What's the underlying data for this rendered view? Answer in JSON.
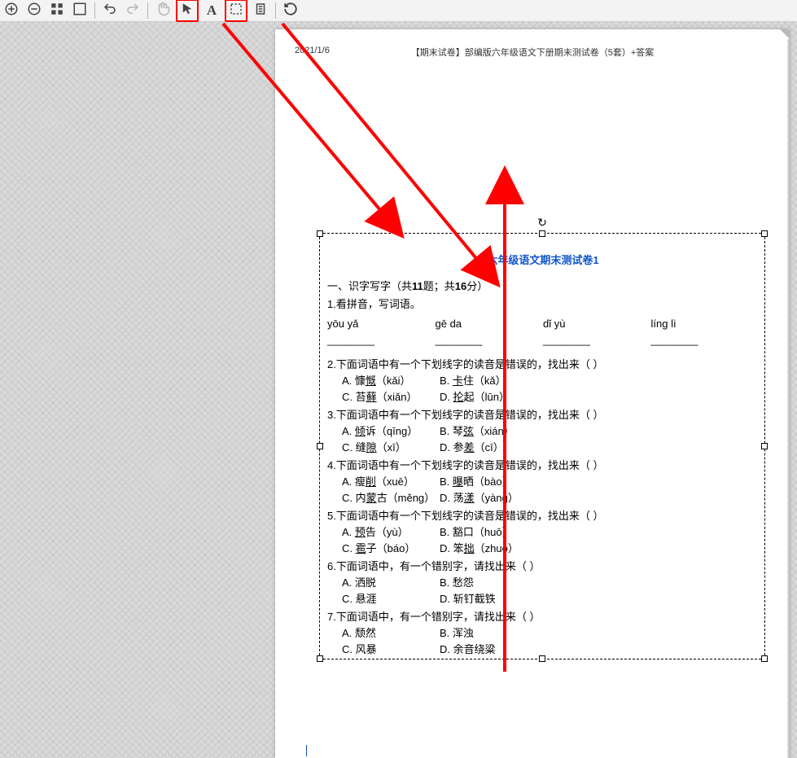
{
  "toolbar": {
    "zoom_in": {
      "name": "zoom-in-icon"
    },
    "zoom_out": {
      "name": "zoom-out-icon"
    },
    "thumbs": {
      "name": "thumbnails-icon"
    },
    "fit": {
      "name": "fit-page-icon"
    },
    "undo": {
      "name": "undo-icon"
    },
    "redo": {
      "name": "redo-icon"
    },
    "hand": {
      "name": "hand-tool-icon"
    },
    "pointer": {
      "name": "pointer-tool-icon"
    },
    "text": {
      "name": "text-tool-label",
      "label": "A"
    },
    "marquee": {
      "name": "marquee-select-icon"
    },
    "clipboard": {
      "name": "clipboard-icon"
    },
    "refresh": {
      "name": "refresh-icon"
    }
  },
  "annotation": {
    "arrow1_from": "pointer-tool",
    "arrow2_from": "marquee-tool",
    "arrow3": "vertical-double-arrow"
  },
  "page_header": {
    "date": "2021/1/6",
    "title": "【期末试卷】部编版六年级语文下册期末测试卷（5套）+答案"
  },
  "selection_handles": {
    "count": 8,
    "rotate_glyph": "↻"
  },
  "doc": {
    "title": "六年级语文期末测试卷1",
    "section": "一、识字写字（共11题；共16分）",
    "q1": {
      "prompt": "1.看拼音，写词语。",
      "pinyin": [
        "yōu yǎ",
        "gē da",
        "dǐ yù",
        "líng lì"
      ],
      "blanks": [
        "________",
        "________",
        "________",
        "________"
      ]
    },
    "q2": {
      "prompt": "2.下面词语中有一个下划线字的读音是错误的，找出来（     ）",
      "opts": [
        {
          "k": "A",
          "t": "慷",
          "u": "慨",
          "py": "（kǎi）"
        },
        {
          "k": "B",
          "t": "",
          "u": "卡",
          "t2": "住",
          "py": "（kǎ）"
        },
        {
          "k": "C",
          "t": "苔",
          "u": "藓",
          "py": "（xiǎn）"
        },
        {
          "k": "D",
          "t": "",
          "u": "抡",
          "t2": "起",
          "py": "（lūn）"
        }
      ]
    },
    "q3": {
      "prompt": "3.下面词语中有一个下划线字的读音是错误的，找出来（     ）",
      "opts": [
        {
          "k": "A",
          "u": "倾",
          "t2": "诉",
          "py": "（qīng）"
        },
        {
          "k": "B",
          "t": "琴",
          "u": "弦",
          "py": "（xián）"
        },
        {
          "k": "C",
          "t": "缝",
          "u": "隙",
          "py": "（xī）"
        },
        {
          "k": "D",
          "t": "参",
          "u": "差",
          "py": "（cī）"
        }
      ]
    },
    "q4": {
      "prompt": "4.下面词语中有一个下划线字的读音是错误的，找出来（     ）",
      "opts": [
        {
          "k": "A",
          "t": "瘦",
          "u": "削",
          "py": "（xuē）"
        },
        {
          "k": "B",
          "u": "曝",
          "t2": "晒",
          "py": "（bào）"
        },
        {
          "k": "C",
          "t": "内",
          "u": "蒙",
          "t2": "古",
          "py": "（měng）"
        },
        {
          "k": "D",
          "t": "荡",
          "u": "漾",
          "py": "（yànɡ）"
        }
      ]
    },
    "q5": {
      "prompt": "5.下面词语中有一个下划线字的读音是错误的，找出来（     ）",
      "opts": [
        {
          "k": "A",
          "u": "预",
          "t2": "告",
          "py": "（yù）"
        },
        {
          "k": "B",
          "t": "豁口",
          "py": "（huō）"
        },
        {
          "k": "C",
          "u": "雹",
          "t2": "子",
          "py": "（báo）"
        },
        {
          "k": "D",
          "t": "笨",
          "u": "拙",
          "py": "（zhuó）"
        }
      ]
    },
    "q6": {
      "prompt": "6.下面词语中，有一个错别字，请找出来（     ）",
      "opts": [
        {
          "k": "A",
          "t": "洒脱"
        },
        {
          "k": "B",
          "t": "愁怨"
        },
        {
          "k": "C",
          "t": "悬涯"
        },
        {
          "k": "D",
          "t": "斩钉截铁"
        }
      ]
    },
    "q7": {
      "prompt": "7.下面词语中，有一个错别字，请找出来（     ）",
      "opts": [
        {
          "k": "A",
          "t": "颓然"
        },
        {
          "k": "B",
          "t": "浑浊"
        },
        {
          "k": "C",
          "t": "风暴"
        },
        {
          "k": "D",
          "t": "余音绕粱"
        }
      ]
    }
  }
}
